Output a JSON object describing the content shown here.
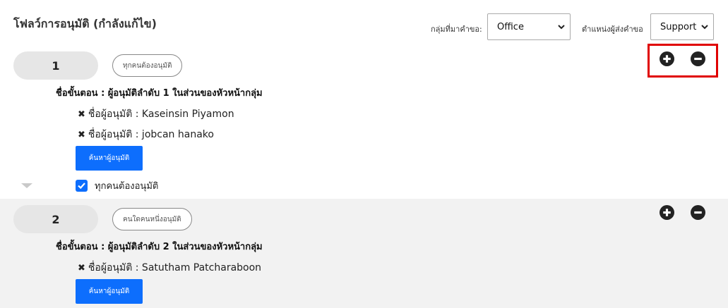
{
  "page": {
    "title": "โฟลว์การอนุมัติ (กำลังแก้ไข)"
  },
  "filters": {
    "group_label": "กลุ่มที่มาคำขอ:",
    "group_value": "Office",
    "position_label": "ตำแหน่งผู้ส่งคำขอ",
    "position_value": "Support"
  },
  "steps": [
    {
      "number": "1",
      "mode_tag": "ทุกคนต้องอนุมัติ",
      "name": "ชื่อขั้นตอน : ผู้อนุมัติลำดับ 1 ในส่วนของหัวหน้ากลุ่ม",
      "approvers": [
        "ชื่อผู้อนุมัติ : Kaseinsin Piyamon",
        "ชื่อผู้อนุมัติ : jobcan hanako"
      ],
      "search_button": "ค้นหาผู้อนุมัติ",
      "checkbox_label": "ทุกคนต้องอนุมัติ",
      "checkbox_checked": true
    },
    {
      "number": "2",
      "mode_tag": "คนใดคนหนึ่งอนุมัติ",
      "name": "ชื่อขั้นตอน : ผู้อนุมัติลำดับ 2 ในส่วนของหัวหน้ากลุ่ม",
      "approvers": [
        "ชื่อผู้อนุมัติ : Satutham Patcharaboon"
      ],
      "search_button": "ค้นหาผู้อนุมัติ"
    }
  ],
  "colors": {
    "primary": "#0d6efd",
    "highlight": "#e00000",
    "alt_row": "#f2f2f2"
  },
  "icons": {
    "add": "plus-circle-icon",
    "remove": "minus-circle-icon",
    "remove_approver": "x-icon",
    "collapse": "caret-down-icon"
  }
}
